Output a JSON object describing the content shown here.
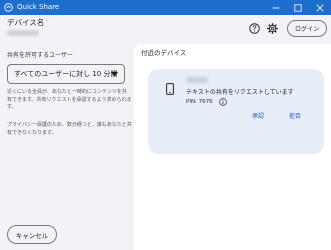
{
  "window": {
    "title": "Quick Share",
    "controls": [
      "minimize",
      "maximize",
      "close"
    ]
  },
  "left": {
    "device_label": "デバイス名",
    "share_label": "共有を許可するユーザー",
    "visibility": {
      "selected": "すべてのユーザーに対し 10 分間"
    },
    "description1_lines": [
      "近くにいる全員が、あなたと一時的にコンテンツを共",
      "有できます。共有リクエストを承認するよう求められま",
      "す。"
    ],
    "description2_lines": [
      "プライバシー保護のため、数分経つと、誰もあなたと共",
      "有できなくなります。"
    ],
    "cancel_label": "キャンセル"
  },
  "header": {
    "login_label": "ログイン",
    "icons": [
      "help-icon",
      "gear-icon"
    ]
  },
  "nearby": {
    "title": "付近のデバイス",
    "card": {
      "message": "テキストの共有をリクエストしています",
      "pin": "PIN: 7676",
      "accept_label": "承認",
      "decline_label": "拒否"
    }
  },
  "colors": {
    "titlebar": "#1e6ed0",
    "background": "#f2f3f7",
    "panel": "#ffffff",
    "card": "#e7eef8",
    "accent": "#1a5fc4"
  }
}
